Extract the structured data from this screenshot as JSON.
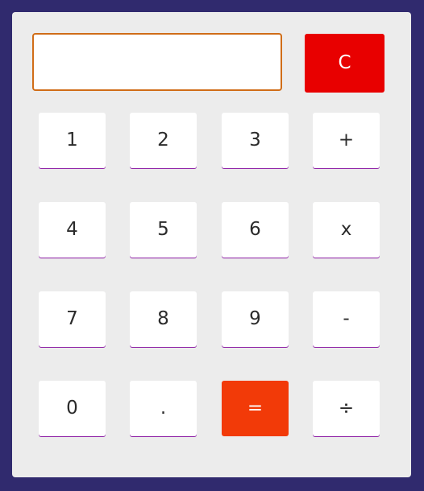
{
  "display": {
    "value": ""
  },
  "clear": {
    "label": "C"
  },
  "keys": {
    "one": "1",
    "two": "2",
    "three": "3",
    "plus": "+",
    "four": "4",
    "five": "5",
    "six": "6",
    "multiply": "x",
    "seven": "7",
    "eight": "8",
    "nine": "9",
    "minus": "-",
    "zero": "0",
    "decimal": ".",
    "equals": "=",
    "divide": "÷"
  },
  "colors": {
    "page_background": "#302a6e",
    "panel_background": "#ececec",
    "clear_button": "#e80000",
    "equals_button": "#f23a08",
    "display_border": "#d06d18",
    "key_underline": "#8b1aa3"
  }
}
